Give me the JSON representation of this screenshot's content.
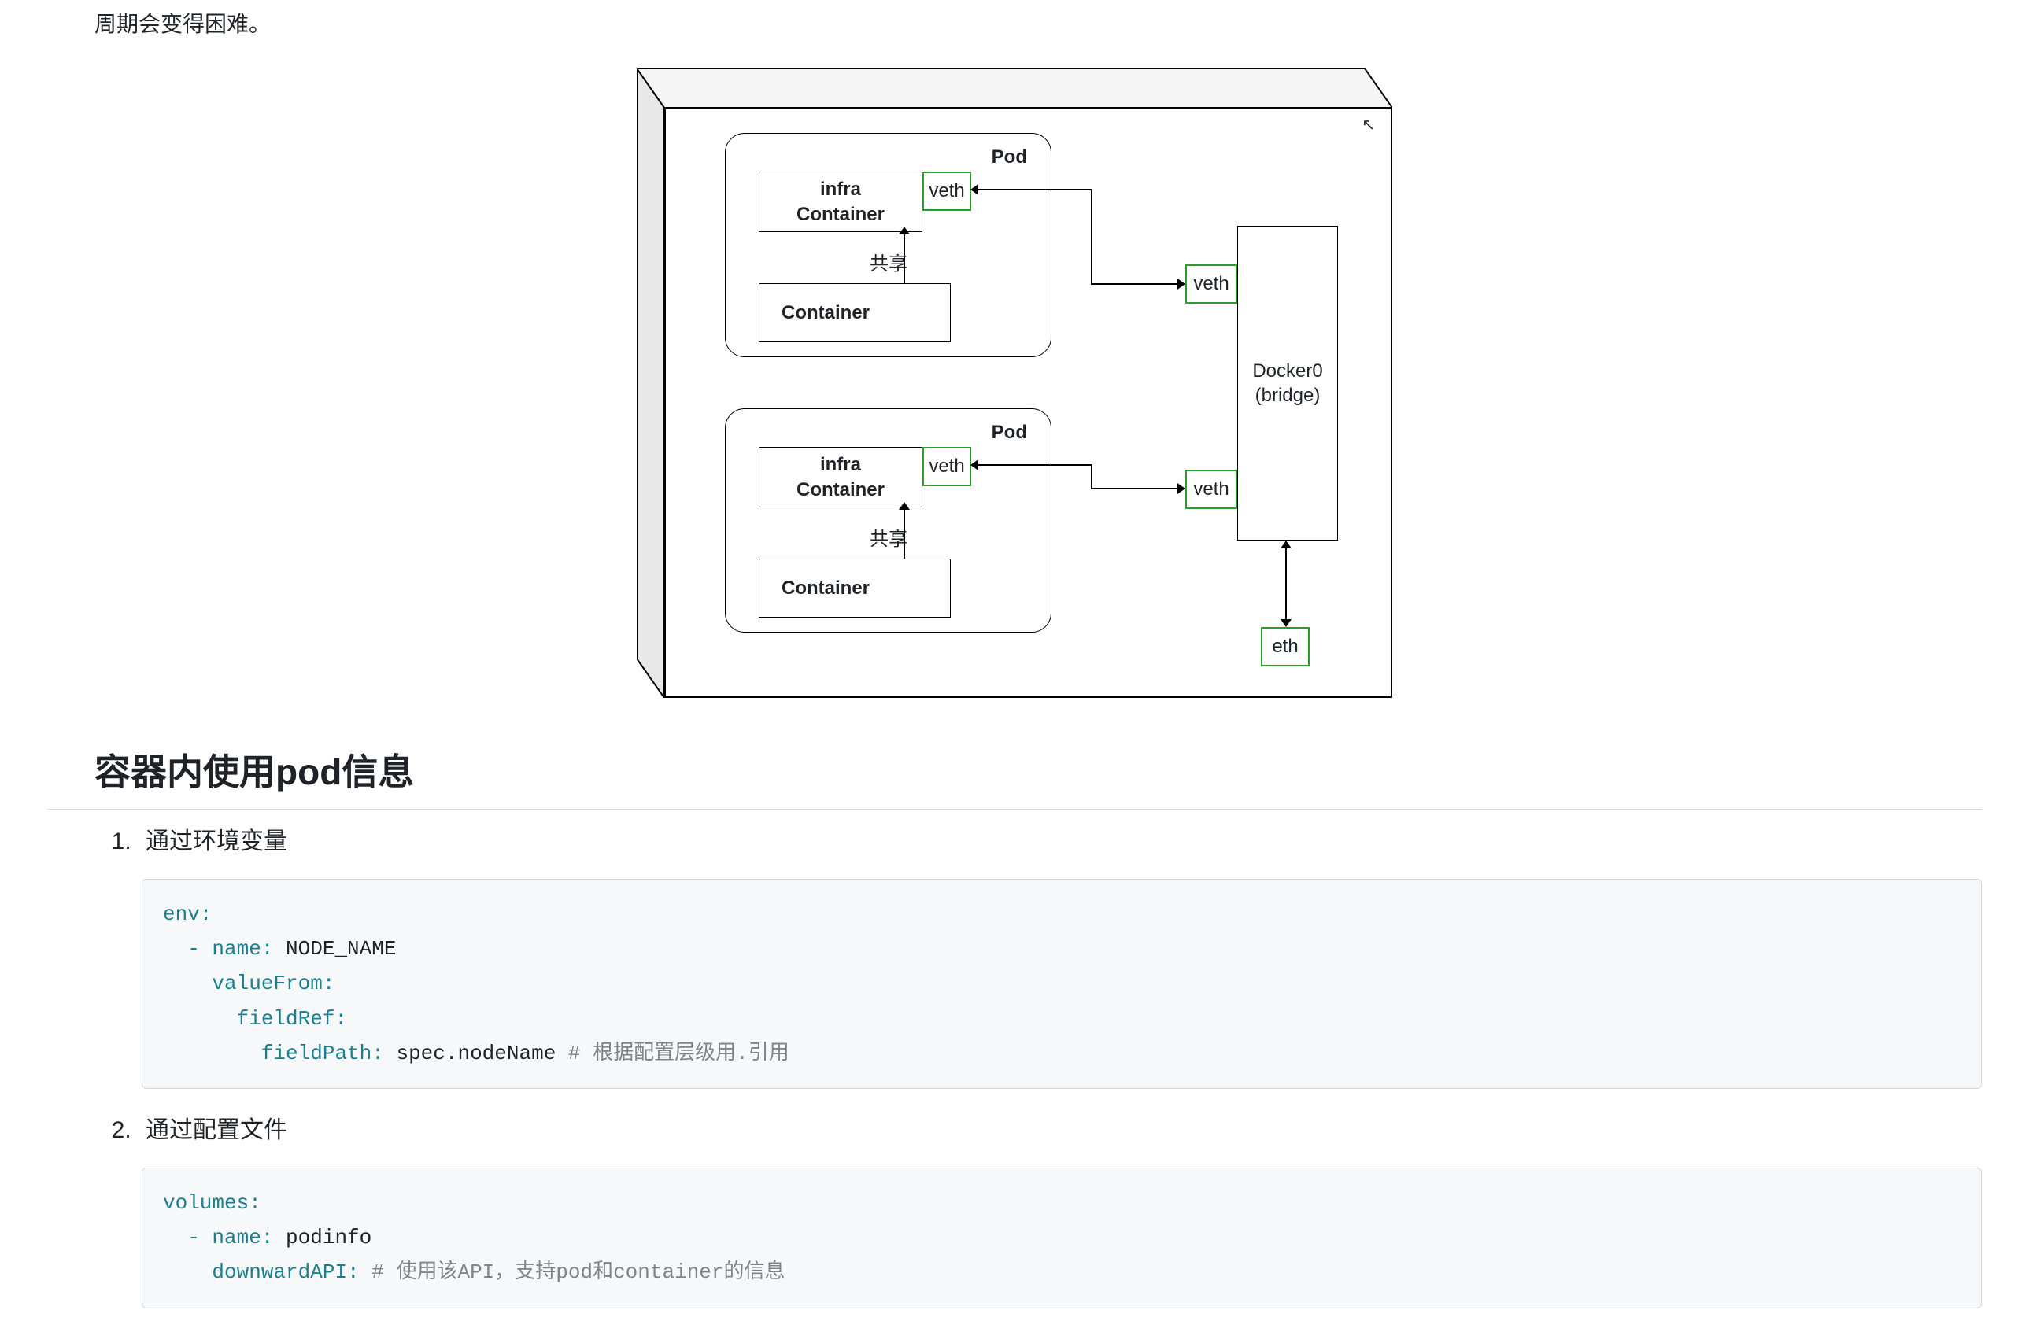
{
  "intro": "周期会变得困难。",
  "diagram": {
    "pod1": {
      "label": "Pod",
      "infraContainer": "infra\nContainer",
      "container": "Container",
      "veth": "veth",
      "share": "共享"
    },
    "pod2": {
      "label": "Pod",
      "infraContainer": "infra\nContainer",
      "container": "Container",
      "veth": "veth",
      "share": "共享"
    },
    "bridgeVeth1": "veth",
    "bridgeVeth2": "veth",
    "docker0": "Docker0\n(bridge)",
    "eth": "eth"
  },
  "heading": "容器内使用pod信息",
  "list": {
    "item1": "通过环境变量",
    "item2": "通过配置文件"
  },
  "code1": {
    "keys": {
      "env": "env:",
      "name": "- name:",
      "valueFrom": "valueFrom:",
      "fieldRef": "fieldRef:",
      "fieldPath": "fieldPath:"
    },
    "values": {
      "nodeName": " NODE_NAME",
      "specNodeName": " spec.nodeName"
    },
    "comment": " # 根据配置层级用.引用"
  },
  "code2": {
    "keys": {
      "volumes": "volumes:",
      "name": "- name:",
      "downwardAPI": "downwardAPI:"
    },
    "values": {
      "podinfo": " podinfo"
    },
    "comment": " # 使用该API，支持pod和container的信息"
  }
}
